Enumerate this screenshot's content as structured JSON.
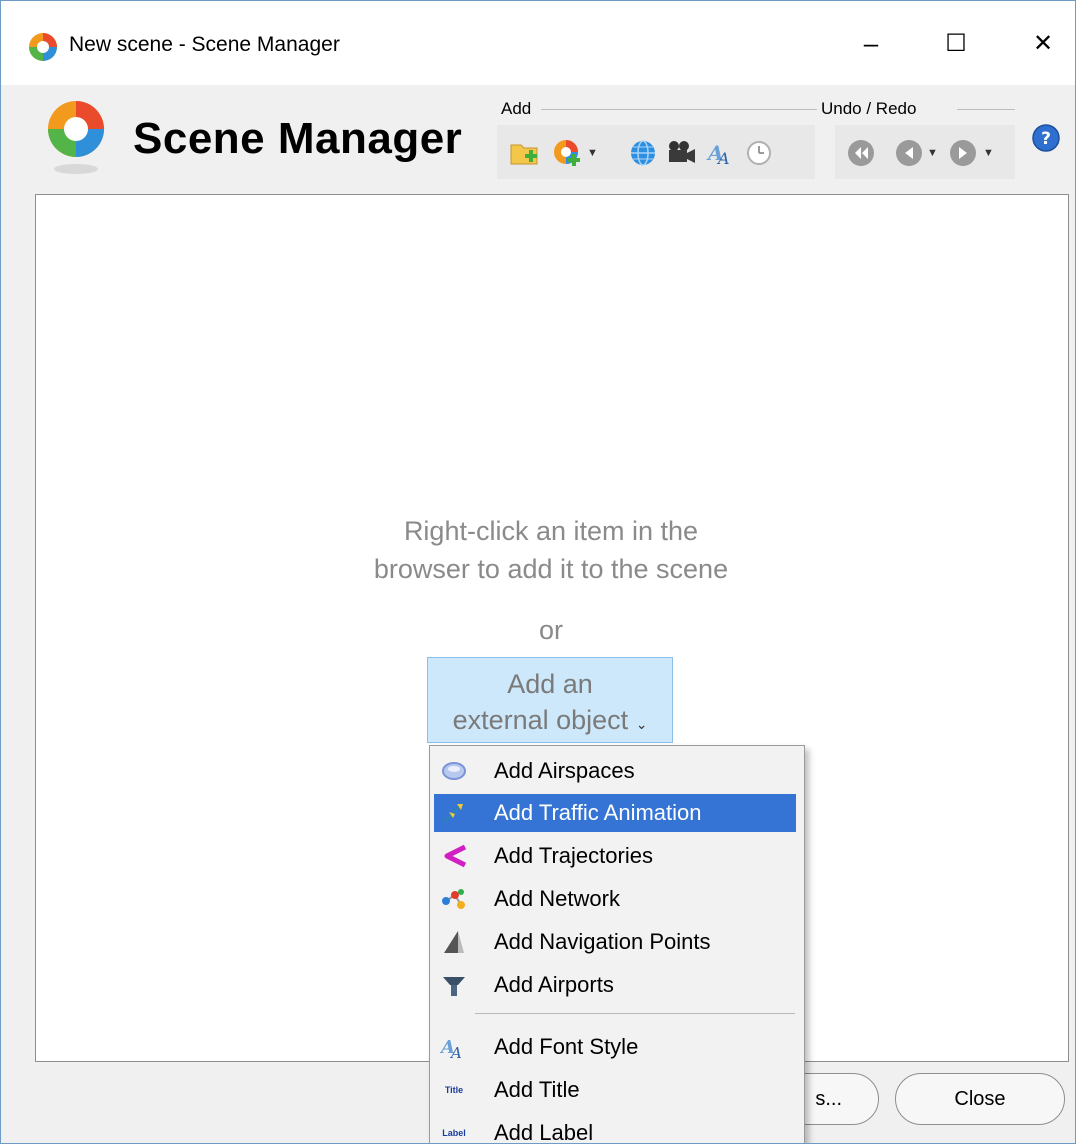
{
  "window": {
    "title": "New scene - Scene Manager",
    "minimize": "–",
    "maximize": "☐",
    "close": "✕"
  },
  "header": {
    "app_name": "Scene Manager",
    "add_group_label": "Add",
    "undo_group_label": "Undo / Redo",
    "add_tools": [
      "add-folder",
      "add-object",
      "add-globe",
      "add-camera",
      "add-font-style",
      "add-clock"
    ],
    "undo_tools": [
      "rewind",
      "undo",
      "redo"
    ]
  },
  "content": {
    "hint_line1": "Right-click an item in the",
    "hint_line2": "browser to add it to the scene",
    "or": "or",
    "external_line1": "Add an",
    "external_line2": "external object",
    "external_caret": "⌄"
  },
  "menu": {
    "items": [
      {
        "label": "Add Airspaces",
        "icon": "airspaces-icon",
        "active": false
      },
      {
        "label": "Add Traffic Animation",
        "icon": "traffic-animation-icon",
        "active": true
      },
      {
        "label": "Add Trajectories",
        "icon": "trajectories-icon",
        "active": false
      },
      {
        "label": "Add Network",
        "icon": "network-icon",
        "active": false
      },
      {
        "label": "Add Navigation Points",
        "icon": "navigation-points-icon",
        "active": false
      },
      {
        "label": "Add Airports",
        "icon": "airports-icon",
        "active": false
      },
      {
        "label": "Add Font Style",
        "icon": "font-style-icon",
        "active": false
      },
      {
        "label": "Add Title",
        "icon": "title-icon",
        "active": false
      },
      {
        "label": "Add Label",
        "icon": "label-icon",
        "active": false
      }
    ],
    "title_icon_text": "Title",
    "label_icon_text": "Label"
  },
  "footer": {
    "partial_button": "s...",
    "close_button": "Close"
  },
  "colors": {
    "accent": "#3574d4",
    "external_button_bg": "#cde8fb",
    "hint_text": "#8a8a8a"
  }
}
